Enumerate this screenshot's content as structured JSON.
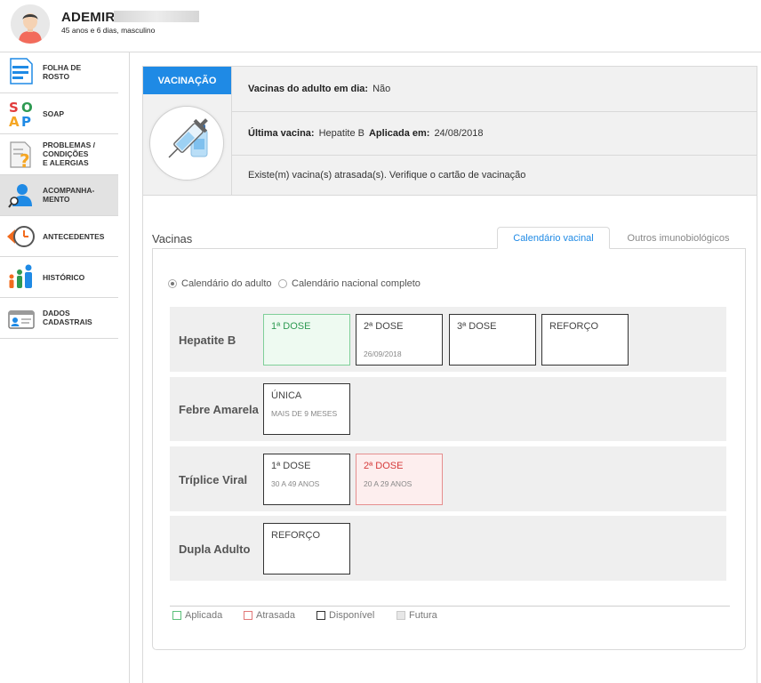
{
  "patient": {
    "name": "ADEMIR",
    "info": "45 anos e 6 dias, masculino"
  },
  "sidebar": {
    "items": [
      {
        "label_1": "FOLHA DE",
        "label_2": "ROSTO",
        "icon": "document-icon"
      },
      {
        "label_1": "SOAP",
        "icon": "soap-icon"
      },
      {
        "label_1": "PROBLEMAS /",
        "label_2": "CONDIÇÕES",
        "label_3": "E ALERGIAS",
        "icon": "question-document-icon"
      },
      {
        "label_1": "ACOMPANHA-",
        "label_2": "MENTO",
        "icon": "person-search-icon"
      },
      {
        "label_1": "ANTECEDENTES",
        "icon": "clock-history-icon"
      },
      {
        "label_1": "HISTÓRICO",
        "icon": "family-history-icon"
      },
      {
        "label_1": "DADOS",
        "label_2": "CADASTRAIS",
        "icon": "id-card-icon"
      }
    ]
  },
  "vaccination": {
    "tag": "VACINAÇÃO",
    "up_to_date_label": "Vacinas do adulto em dia:",
    "up_to_date_value": "Não",
    "last_vaccine_label": "Última vacina:",
    "last_vaccine_value": "Hepatite B",
    "applied_on_label": "Aplicada em:",
    "applied_on_value": "24/08/2018",
    "warning": "Existe(m) vacina(s) atrasada(s). Verifique o cartão de vacinação"
  },
  "vaccines_section": {
    "title": "Vacinas",
    "tabs": [
      "Calendário vacinal",
      "Outros imunobiológicos"
    ],
    "radio_options": [
      "Calendário do adulto",
      "Calendário nacional completo"
    ],
    "rows": [
      {
        "name": "Hepatite B",
        "doses": [
          {
            "title": "1ª DOSE",
            "sub": "",
            "status": "applied"
          },
          {
            "title": "2ª DOSE",
            "sub": "26/09/2018",
            "status": "available"
          },
          {
            "title": "3ª DOSE",
            "sub": "",
            "status": "available"
          },
          {
            "title": "REFORÇO",
            "sub": "",
            "status": "available"
          }
        ]
      },
      {
        "name": "Febre Amarela",
        "doses": [
          {
            "title": "ÚNICA",
            "sub": "MAIS DE 9 MESES",
            "status": "available"
          }
        ]
      },
      {
        "name": "Tríplice Viral",
        "doses": [
          {
            "title": "1ª DOSE",
            "sub": "30 A 49 ANOS",
            "status": "available"
          },
          {
            "title": "2ª DOSE",
            "sub": "20 A 29 ANOS",
            "status": "late"
          }
        ]
      },
      {
        "name": "Dupla Adulto",
        "doses": [
          {
            "title": "REFORÇO",
            "sub": "",
            "status": "available"
          }
        ]
      }
    ],
    "legend": [
      {
        "label": "Aplicada",
        "color": "#5bc07a"
      },
      {
        "label": "Atrasada",
        "color": "#e27878"
      },
      {
        "label": "Disponível",
        "color": "#333333"
      },
      {
        "label": "Futura",
        "color": "#c9c9c9"
      }
    ]
  },
  "colors": {
    "accent": "#1f8ae5",
    "applied": "#2e9a52",
    "late": "#d63b3b"
  }
}
